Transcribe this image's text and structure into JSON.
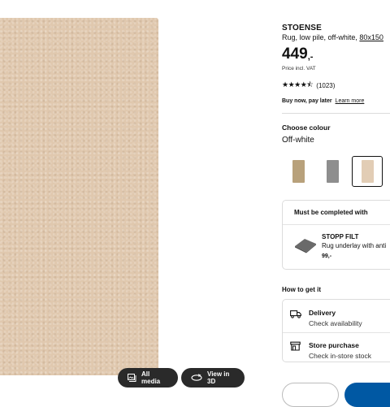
{
  "media": {
    "all_media_label": "All media",
    "view_3d_label": "View in 3D",
    "rug_color": "#e0c8ae"
  },
  "product": {
    "name": "STOENSE",
    "description": "Rug, low pile, off-white,",
    "size_link": "80x150",
    "price_whole": "449",
    "price_decimal": ",-",
    "price_note": "Price incl. VAT",
    "stars": "★★★★⯪",
    "review_count": "(1023)",
    "buy_now_text": "Buy now, pay later",
    "learn_more": "Learn more"
  },
  "colour": {
    "heading": "Choose colour",
    "selected": "Off-white",
    "swatches": [
      {
        "name": "beige",
        "color": "#b8a17b"
      },
      {
        "name": "grey",
        "color": "#8e8e8e"
      },
      {
        "name": "off-white",
        "color": "#e2cdb5",
        "selected": true
      }
    ]
  },
  "complete": {
    "heading": "Must be completed with",
    "item_name": "STOPP FILT",
    "item_desc": "Rug underlay with anti",
    "item_price": "99,-"
  },
  "delivery": {
    "heading": "How to get it",
    "delivery_title": "Delivery",
    "delivery_sub": "Check availability",
    "store_title": "Store purchase",
    "store_sub": "Check in-store stock"
  },
  "colors": {
    "accent": "#0058a3",
    "dark_button": "#2a2a2a"
  }
}
